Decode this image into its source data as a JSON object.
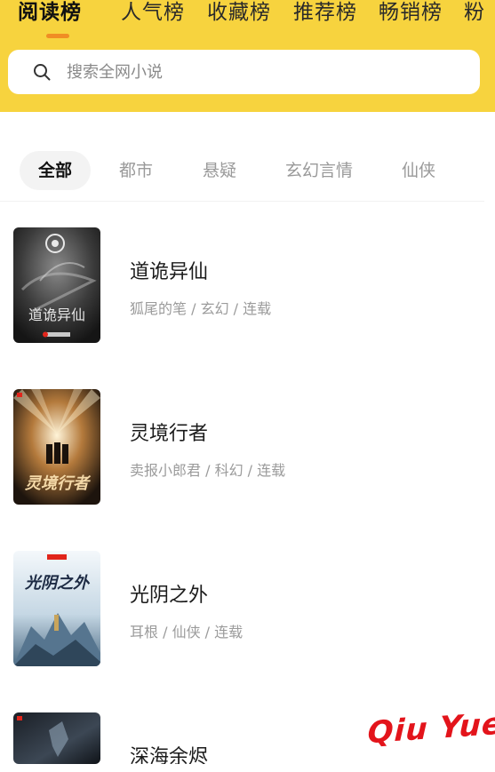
{
  "header": {
    "tabs": [
      {
        "label": "阅读榜",
        "active": true
      },
      {
        "label": "人气榜",
        "active": false
      },
      {
        "label": "收藏榜",
        "active": false
      },
      {
        "label": "推荐榜",
        "active": false
      },
      {
        "label": "畅销榜",
        "active": false
      },
      {
        "label": "粉",
        "active": false
      }
    ],
    "search": {
      "placeholder": "搜索全网小说",
      "icon": "search-icon"
    }
  },
  "categories": [
    {
      "label": "全部",
      "active": true
    },
    {
      "label": "都市",
      "active": false
    },
    {
      "label": "悬疑",
      "active": false
    },
    {
      "label": "玄幻言情",
      "active": false
    },
    {
      "label": "仙侠",
      "active": false
    }
  ],
  "books": [
    {
      "title": "道诡异仙",
      "meta": "狐尾的笔 / 玄幻 / 连载",
      "cover_text": "道诡异仙"
    },
    {
      "title": "灵境行者",
      "meta": "卖报小郎君 / 科幻 / 连载",
      "cover_text": "灵境行者"
    },
    {
      "title": "光阴之外",
      "meta": "耳根 / 仙侠 / 连载",
      "cover_text": "光阴之外"
    },
    {
      "title": "深海余烬",
      "meta": "",
      "cover_text": ""
    }
  ],
  "watermark": "Qiu Yue",
  "colors": {
    "header_bg": "#f7d33e",
    "indicator": "#f08d24",
    "watermark": "#e3141b"
  }
}
